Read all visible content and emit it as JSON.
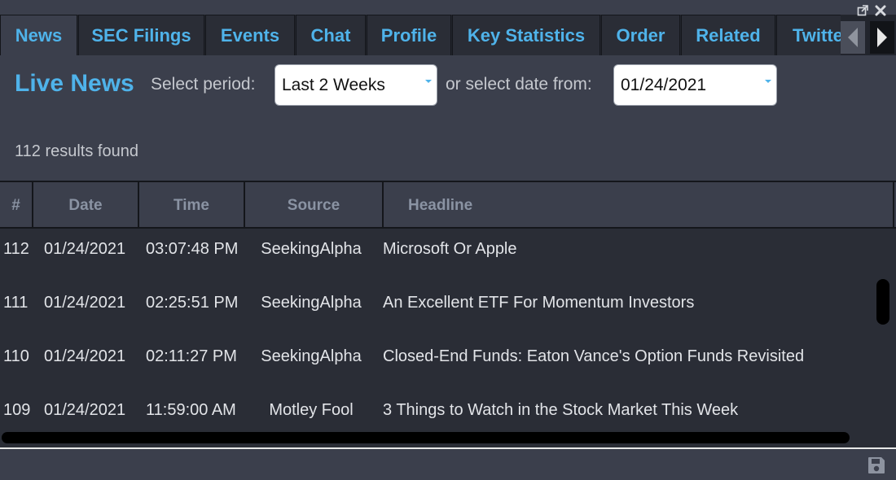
{
  "tabs": [
    {
      "label": "News"
    },
    {
      "label": "SEC Filings"
    },
    {
      "label": "Events"
    },
    {
      "label": "Chat"
    },
    {
      "label": "Profile"
    },
    {
      "label": "Key Statistics"
    },
    {
      "label": "Order"
    },
    {
      "label": "Related"
    },
    {
      "label": "Twitter"
    }
  ],
  "active_tab": "News",
  "header": {
    "title": "Live News",
    "period_label": "Select period:",
    "period_value": "Last 2 Weeks",
    "date_label": "or select date from:",
    "date_value": "01/24/2021"
  },
  "results_text": "112 results found",
  "table": {
    "columns": [
      "#",
      "Date",
      "Time",
      "Source",
      "Headline"
    ],
    "rows": [
      {
        "num": "112",
        "date": "01/24/2021",
        "time": "03:07:48 PM",
        "source": "SeekingAlpha",
        "headline": "Microsoft Or Apple"
      },
      {
        "num": "111",
        "date": "01/24/2021",
        "time": "02:25:51 PM",
        "source": "SeekingAlpha",
        "headline": "An Excellent ETF For Momentum Investors"
      },
      {
        "num": "110",
        "date": "01/24/2021",
        "time": "02:11:27 PM",
        "source": "SeekingAlpha",
        "headline": "Closed-End Funds: Eaton Vance's Option Funds Revisited"
      },
      {
        "num": "109",
        "date": "01/24/2021",
        "time": "11:59:00 AM",
        "source": "Motley Fool",
        "headline": "3 Things to Watch in the Stock Market This Week"
      }
    ]
  },
  "icons": {
    "popout": "popout-icon",
    "close": "close-icon",
    "tab_left": "triangle-left-icon",
    "tab_right": "triangle-right-icon",
    "save": "save-icon"
  },
  "colors": {
    "accent": "#4fb3ea",
    "background": "#3b3f4c",
    "table_bg": "#2a2d36",
    "header_text": "#8a93a3"
  }
}
